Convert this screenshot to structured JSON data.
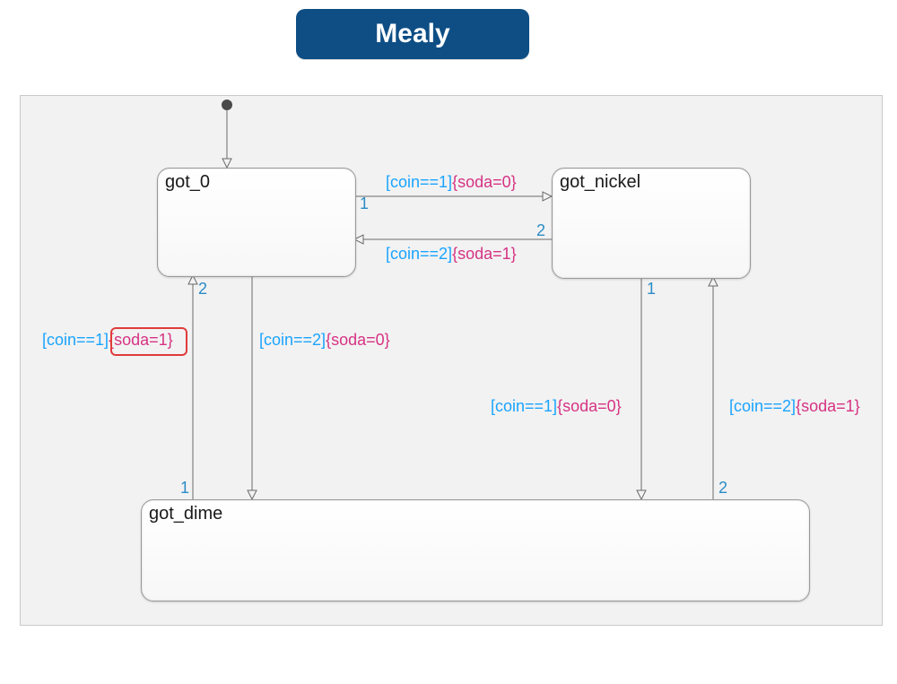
{
  "title": "Mealy",
  "states": {
    "got_0": {
      "label": "got_0"
    },
    "got_nickel": {
      "label": "got_nickel"
    },
    "got_dime": {
      "label": "got_dime"
    }
  },
  "transitions": {
    "got0_to_nickel": {
      "priority": "1",
      "condition": "[coin==1]",
      "action": "{soda=0}"
    },
    "nickel_to_got0": {
      "priority": "2",
      "condition": "[coin==2]",
      "action": "{soda=1}"
    },
    "dime_to_got0": {
      "priority": "1",
      "condition": "[coin==1]",
      "action": "{soda=1}",
      "highlight_action": true
    },
    "got0_to_dime": {
      "priority": "2",
      "condition": "[coin==2]",
      "action": "{soda=0}"
    },
    "nickel_to_dime": {
      "priority": "1",
      "condition": "[coin==1]",
      "action": "{soda=0}"
    },
    "dime_to_nickel": {
      "priority": "2",
      "condition": "[coin==2]",
      "action": "{soda=1}"
    }
  }
}
